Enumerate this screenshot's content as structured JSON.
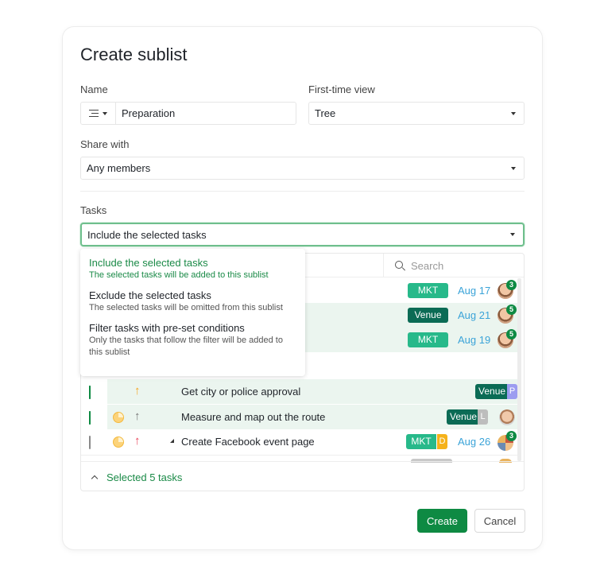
{
  "dialog": {
    "title": "Create sublist",
    "name_label": "Name",
    "name_value": "Preparation",
    "first_view_label": "First-time view",
    "first_view_value": "Tree",
    "share_label": "Share with",
    "share_value": "Any members",
    "tasks_label": "Tasks",
    "tasks_value": "Include the selected tasks"
  },
  "tasks_menu": [
    {
      "title": "Include the selected tasks",
      "desc": "The selected tasks will be added to this sublist",
      "active": true
    },
    {
      "title": "Exclude the selected tasks",
      "desc": "The selected tasks will be omitted from this sublist",
      "active": false
    },
    {
      "title": "Filter tasks with pre-set conditions",
      "desc": "Only the tasks that follow the filter will be added to this sublist",
      "active": false
    }
  ],
  "panel": {
    "search_placeholder": "Search",
    "rows": [
      {
        "checked": null,
        "name": "",
        "tag": "MKT",
        "date": "Aug 17",
        "badge": "3"
      },
      {
        "checked": null,
        "name": "",
        "tag": "Venue",
        "date": "Aug 21",
        "badge": "5"
      },
      {
        "checked": null,
        "name": "",
        "tag": "MKT",
        "date": "Aug 19",
        "badge": "5"
      },
      {
        "checked": true,
        "name": "Get city or police approval",
        "tag": "Venue",
        "assignee_initial": "P",
        "priority": "high"
      },
      {
        "checked": true,
        "name": "Measure and map out the route",
        "tag": "Venue",
        "assignee_initial": "L",
        "priority": "normal"
      },
      {
        "checked": false,
        "name": "Create Facebook event page",
        "tag": "MKT",
        "assignee_initial": "D",
        "date": "Aug 26",
        "badge": "3",
        "priority": "urgent"
      }
    ],
    "footer": "Selected 5 tasks"
  },
  "buttons": {
    "create": "Create",
    "cancel": "Cancel"
  },
  "colors": {
    "primary": "#0e8a43",
    "mkt_tag": "#27b98a",
    "venue_tag": "#0b6b55",
    "date": "#3aa3d8"
  }
}
